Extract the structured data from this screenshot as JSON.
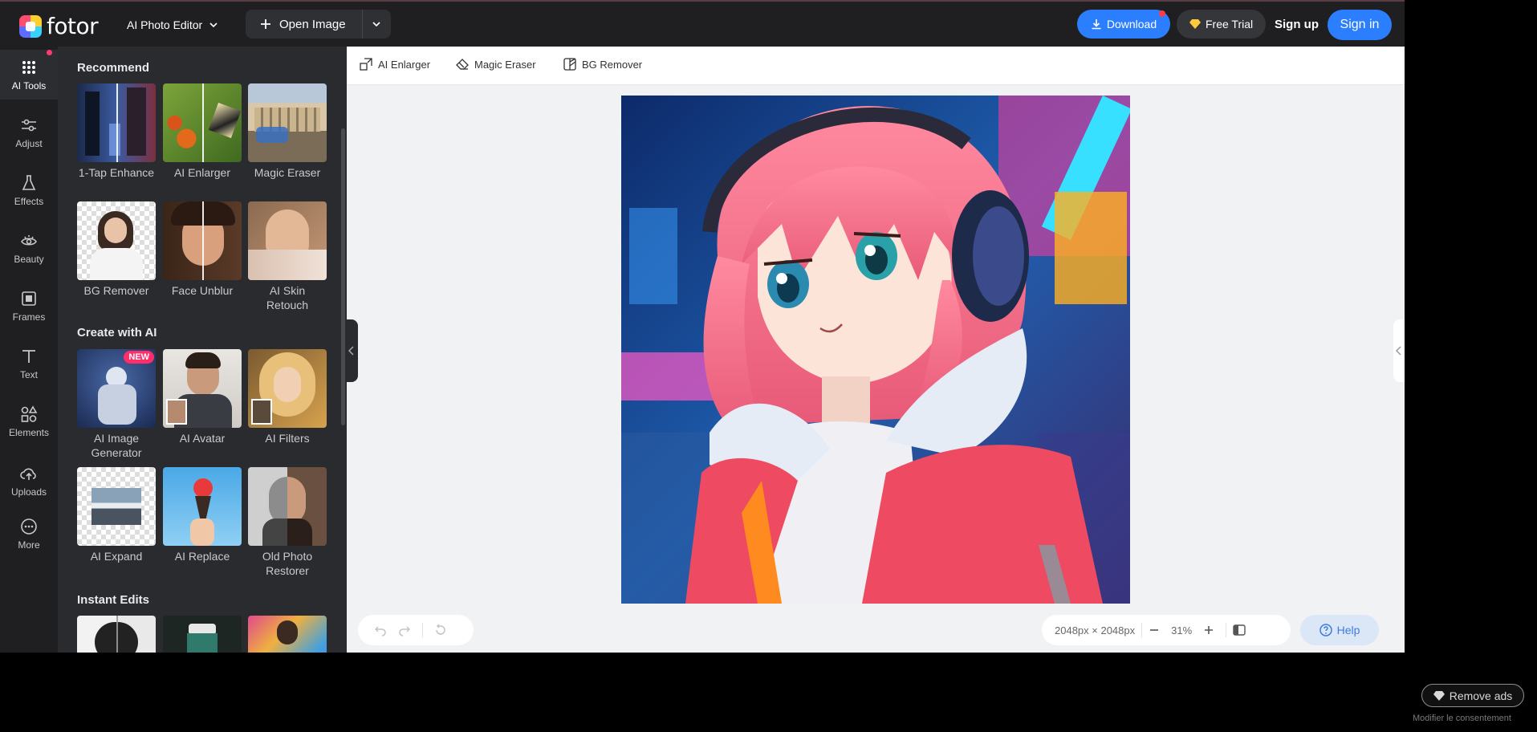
{
  "header": {
    "logo_text": "fotor",
    "editor_label": "AI Photo Editor",
    "open_image_label": "Open Image",
    "download_label": "Download",
    "free_trial_label": "Free Trial",
    "sign_up_label": "Sign up",
    "sign_in_label": "Sign in"
  },
  "rail": {
    "items": [
      {
        "label": "AI Tools",
        "icon": "grid-dots-icon"
      },
      {
        "label": "Adjust",
        "icon": "sliders-icon"
      },
      {
        "label": "Effects",
        "icon": "flask-icon"
      },
      {
        "label": "Beauty",
        "icon": "eye-icon"
      },
      {
        "label": "Frames",
        "icon": "frame-icon"
      },
      {
        "label": "Text",
        "icon": "text-icon"
      },
      {
        "label": "Elements",
        "icon": "shapes-icon"
      },
      {
        "label": "Uploads",
        "icon": "cloud-upload-icon"
      },
      {
        "label": "More",
        "icon": "more-dots-icon"
      }
    ]
  },
  "panel": {
    "recommend_title": "Recommend",
    "recommend": [
      "1-Tap Enhance",
      "AI Enlarger",
      "Magic Eraser",
      "BG Remover",
      "Face Unblur",
      "AI Skin Retouch"
    ],
    "create_title": "Create with AI",
    "create": [
      "AI Image Generator",
      "AI Avatar",
      "AI Filters",
      "AI Expand",
      "AI Replace",
      "Old Photo Restorer"
    ],
    "new_badge": "NEW",
    "instant_title": "Instant Edits"
  },
  "subbar": {
    "ai_enlarger": "AI Enlarger",
    "magic_eraser": "Magic Eraser",
    "bg_remover": "BG Remover"
  },
  "canvas": {
    "dimensions": "2048px × 2048px",
    "zoom": "31%",
    "help_label": "Help"
  },
  "ads": {
    "remove_ads_label": "Remove ads",
    "consent_label": "Modifier le consentement"
  },
  "colors": {
    "accent": "#2b7fff",
    "header_bg": "#1f1f22",
    "panel_bg": "#2a2b2f",
    "badge": "#ff2d6a"
  }
}
